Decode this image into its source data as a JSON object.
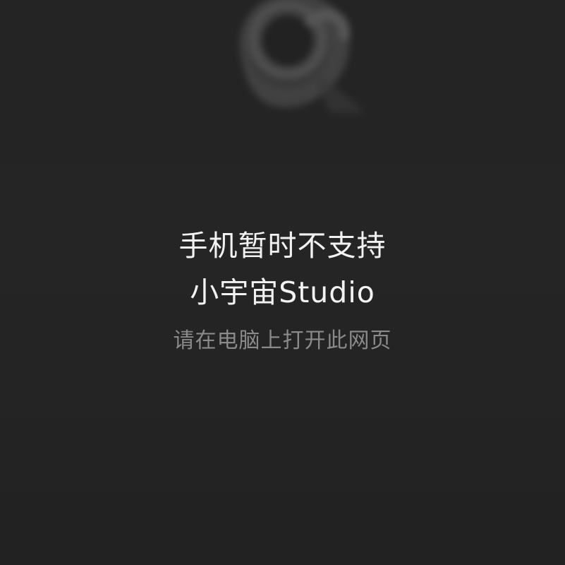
{
  "colors": {
    "background": "#232323",
    "headline_text": "#f2f2f2",
    "hint_text": "#8a8a8a",
    "logo_ring": "#6a6a6a"
  },
  "logo": {
    "icon": "blurred-ring-logo-icon"
  },
  "message": {
    "line1": "手机暂时不支持",
    "line2": "小宇宙Studio",
    "hint": "请在电脑上打开此网页"
  }
}
